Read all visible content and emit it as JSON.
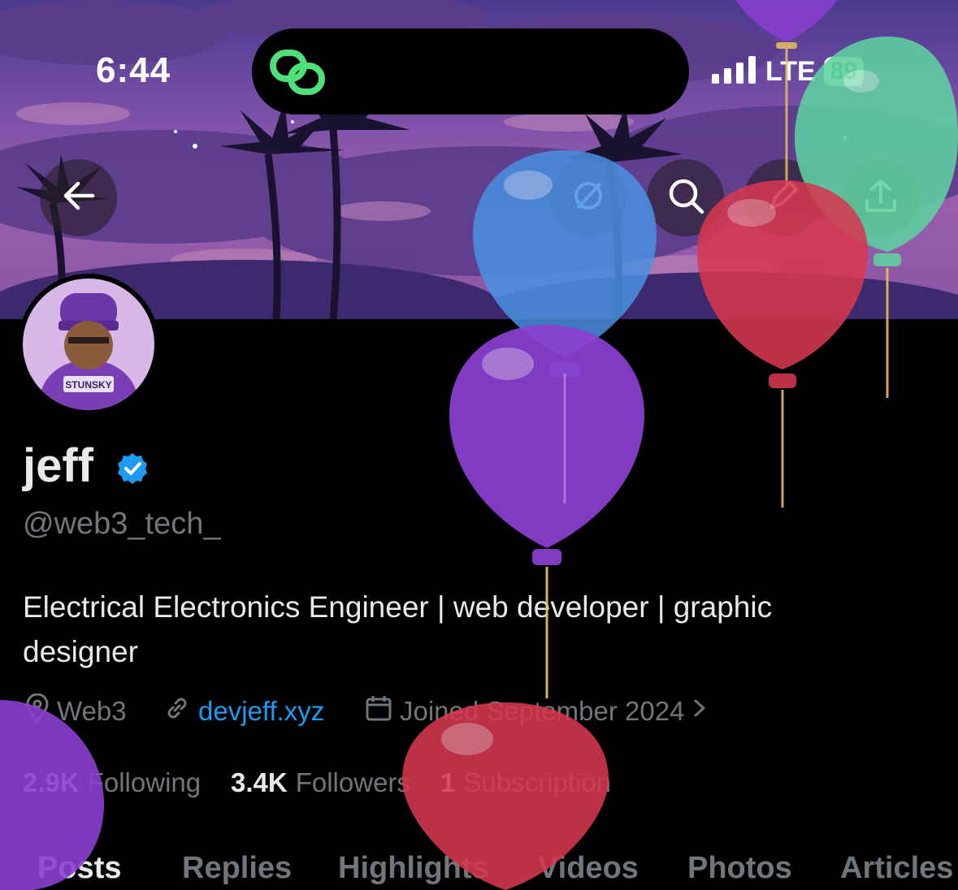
{
  "status_bar": {
    "time": "6:44",
    "network": "LTE",
    "battery": "89"
  },
  "header": {
    "back_icon": "arrow-left-icon",
    "grok_icon": "slash-circle-icon",
    "search_icon": "search-icon",
    "edit_icon": "pencil-icon",
    "share_icon": "share-icon"
  },
  "profile": {
    "name": "jeff",
    "handle": "@web3_tech_",
    "bio": "Electrical Electronics Engineer | web developer | graphic designer",
    "location": "Web3",
    "website": "devjeff.xyz",
    "joined": "Joined September 2024",
    "following_count": "2.9K",
    "following_label": "Following",
    "followers_count": "3.4K",
    "followers_label": "Followers",
    "subscriptions_count": "1",
    "subscriptions_label": "Subscription",
    "avatar_text": "STUNSKY"
  },
  "tabs": [
    "Posts",
    "Replies",
    "Highlights",
    "Videos",
    "Photos",
    "Articles"
  ],
  "colors": {
    "verified": "#1d9bf0",
    "link": "#1d9bf0",
    "balloon_blue": "#4a90e2",
    "balloon_purple": "#8b3fd1",
    "balloon_red": "#d6384f",
    "balloon_green": "#5fd1a0"
  }
}
